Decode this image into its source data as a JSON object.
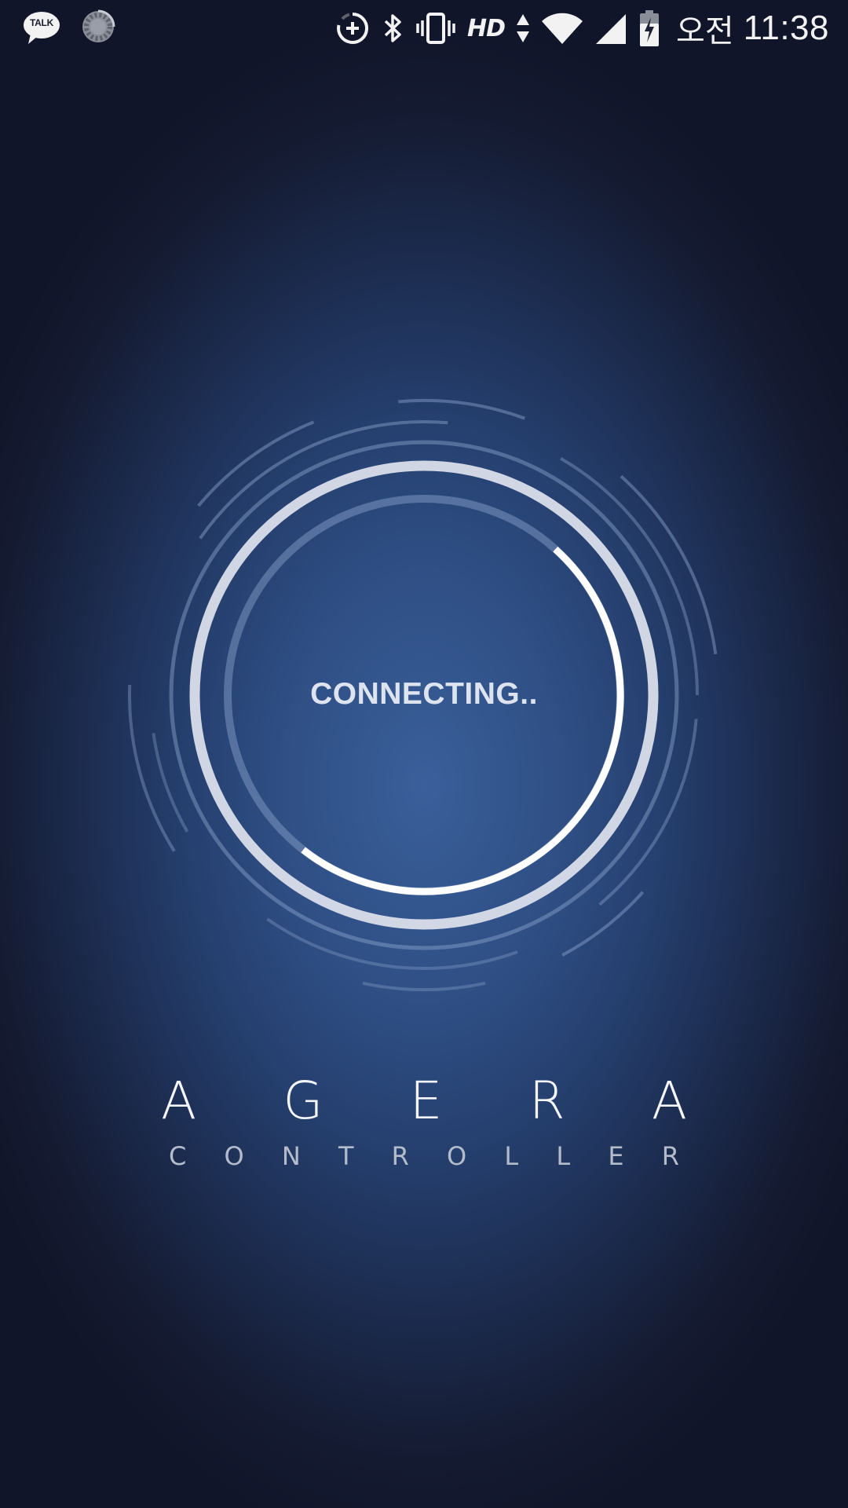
{
  "status_bar": {
    "talk_label": "TALK",
    "hd_label": "HD",
    "ampm": "오전",
    "time": "11:38",
    "icons": [
      "kakaotalk-icon",
      "sync-icon",
      "data-saver-icon",
      "bluetooth-icon",
      "vibrate-icon",
      "hd-icon",
      "data-arrows-icon",
      "wifi-icon",
      "signal-icon",
      "battery-charging-icon"
    ]
  },
  "loader": {
    "status_text": "CONNECTING..",
    "accent_color": "#ffffff",
    "track_color": "#dfe3ee"
  },
  "brand": {
    "name_letters": [
      "A",
      "G",
      "E",
      "R",
      "A"
    ],
    "sub_letters": [
      "C",
      "O",
      "N",
      "T",
      "R",
      "O",
      "L",
      "L",
      "E",
      "R"
    ]
  }
}
